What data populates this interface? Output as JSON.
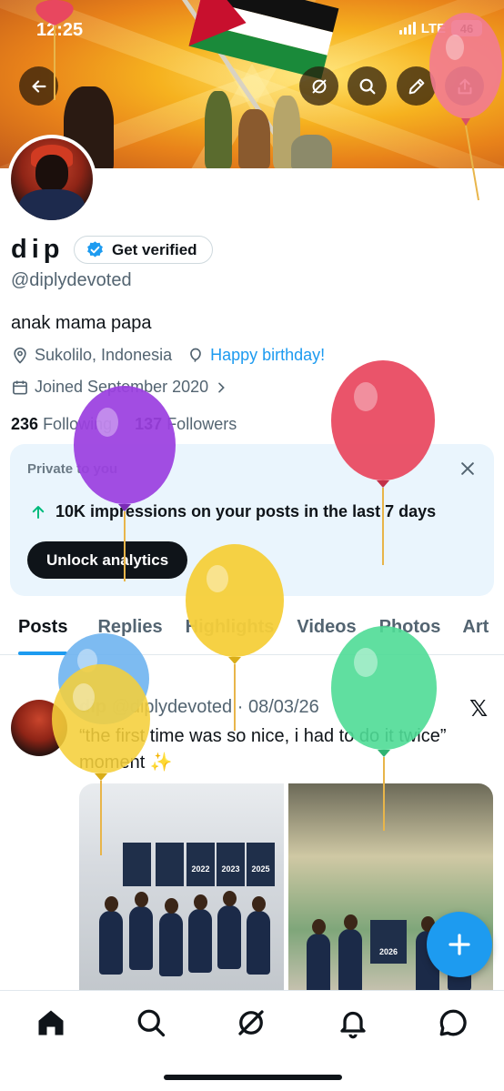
{
  "status_bar": {
    "time": "12:25",
    "network": "LTE",
    "battery": "46"
  },
  "header": {
    "back_icon": "back-arrow-icon",
    "actions": [
      "grok-icon",
      "search-icon",
      "edit-icon",
      "share-icon"
    ]
  },
  "profile": {
    "display_name": "dip",
    "verify_label": "Get verified",
    "handle": "@diplydevoted",
    "bio": "anak mama papa",
    "location": "Sukolilo, Indonesia",
    "birthday_label": "Happy birthday!",
    "joined": "Joined September 2020",
    "following_count": "236",
    "following_label": "Following",
    "followers_count": "137",
    "followers_label": "Followers"
  },
  "private_card": {
    "label": "Private to you",
    "impressions_text": "10K impressions on your posts in the last 7 days",
    "unlock_label": "Unlock analytics"
  },
  "tabs": [
    "Posts",
    "Replies",
    "Highlights",
    "Videos",
    "Photos",
    "Art"
  ],
  "active_tab": "Posts",
  "post": {
    "author": "dip",
    "handle": "@diplydevoted",
    "date": "08/03/26",
    "text": "“the first time was so nice, i had to do it twice” moment ✨",
    "photo1_banners": [
      "2022",
      "2023",
      "2025"
    ],
    "photo2_banner": "2026"
  },
  "colors": {
    "accent": "#1d9bf0",
    "text_primary": "#0f1419",
    "text_secondary": "#536471",
    "card_bg": "#eaf5fd",
    "balloon_purple": "#9b3fe0",
    "balloon_red": "#e8475f",
    "balloon_yellow": "#f5cf3a",
    "balloon_green": "#4fdc96",
    "balloon_blue": "#6fb4ef"
  },
  "bottom_nav": [
    "home-icon",
    "search-icon",
    "grok-icon",
    "notifications-bell-icon",
    "messages-icon"
  ]
}
